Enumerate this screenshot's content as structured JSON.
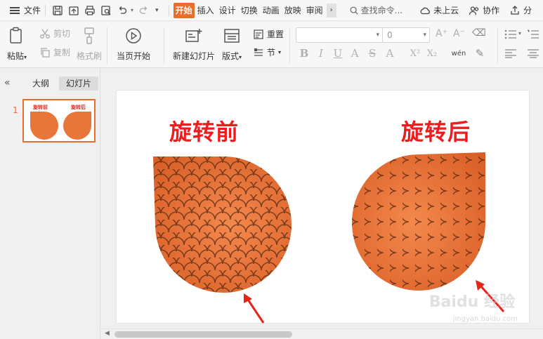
{
  "menubar": {
    "file_label": "文件",
    "tabs": [
      "开始",
      "插入",
      "设计",
      "切换",
      "动画",
      "放映",
      "审阅"
    ],
    "active_tab": "开始",
    "more_label": "›",
    "search_placeholder": "查找命令...",
    "cloud_label": "未上云",
    "collab_label": "协作",
    "share_label": "分"
  },
  "ribbon": {
    "paste": "粘贴",
    "cut": "剪切",
    "copy": "复制",
    "format_painter": "格式刷",
    "play_from_current": "当页开始",
    "new_slide": "新建幻灯片",
    "layout": "版式",
    "reset": "重置",
    "section": "节",
    "font_size_value": "0",
    "pinyin": "wén"
  },
  "leftpanel": {
    "tab_outline": "大纲",
    "tab_slides": "幻灯片",
    "active_tab": "幻灯片",
    "slide_number": "1",
    "thumb_title_left": "旋转前",
    "thumb_title_right": "旋转后"
  },
  "slide": {
    "title_left": "旋转前",
    "title_right": "旋转后"
  },
  "watermark": {
    "brand": "Baidu 经验",
    "url": "jingyan.baidu.com"
  },
  "colors": {
    "accent": "#e96d2c",
    "title_red": "#ee1c1c",
    "tile_orange": "#e8753a",
    "arrow_red": "#e8231a"
  },
  "icons": {
    "save": "save-icon",
    "export": "export-icon",
    "print": "print-icon",
    "preview": "print-preview-icon",
    "undo": "undo-icon",
    "redo": "redo-icon",
    "search": "search-icon",
    "cloud": "cloud-icon",
    "collab": "collaboration-icon"
  }
}
